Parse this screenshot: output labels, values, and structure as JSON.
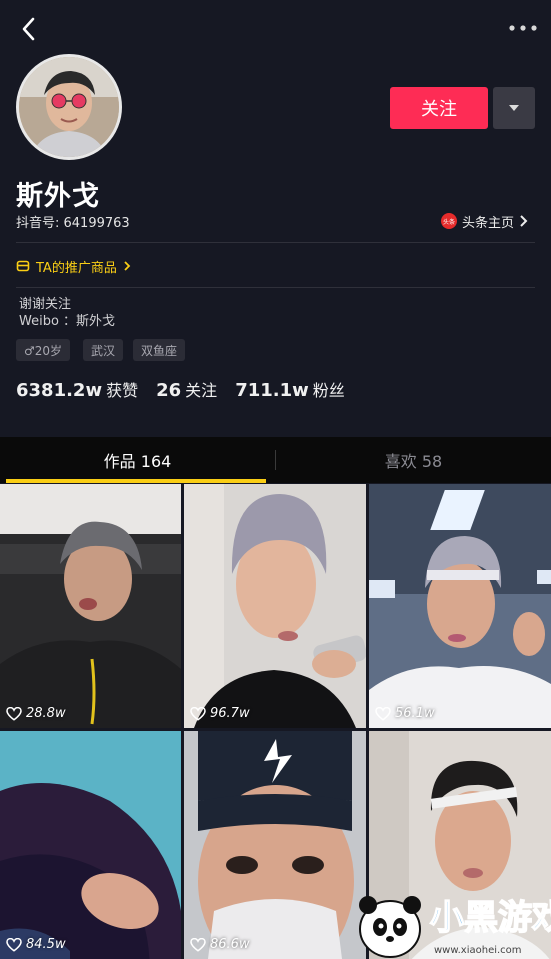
{
  "header": {
    "back_icon": "chevron-left-icon",
    "more_icon": "more-dots-icon"
  },
  "profile": {
    "name": "斯外戈",
    "douyin_id": "抖音号: 64199763",
    "follow_label": "关注",
    "toutiao_badge": "头条",
    "toutiao_label": "头条主页",
    "promo_label": "TA的推广商品",
    "bio": [
      "谢谢关注",
      "Weibo ：斯外戈"
    ],
    "tags": [
      "♂20岁",
      "武汉",
      "双鱼座"
    ]
  },
  "stats": [
    {
      "value": "6381.2w",
      "label": "获赞"
    },
    {
      "value": "26",
      "label": "关注"
    },
    {
      "value": "711.1w",
      "label": "粉丝"
    }
  ],
  "tabs": [
    {
      "label": "作品 164",
      "active": true
    },
    {
      "label": "喜欢 58",
      "active": false
    }
  ],
  "grid": [
    {
      "likes": "28.8w"
    },
    {
      "likes": "96.7w"
    },
    {
      "likes": "56.1w"
    },
    {
      "likes": "84.5w"
    },
    {
      "likes": "86.6w"
    },
    {
      "likes": ""
    }
  ],
  "watermark": {
    "title": "小黑游戏",
    "url": "www.xiaohei.com"
  },
  "colors": {
    "background": "#161823",
    "follow": "#fe2c55",
    "accent": "#face15"
  }
}
